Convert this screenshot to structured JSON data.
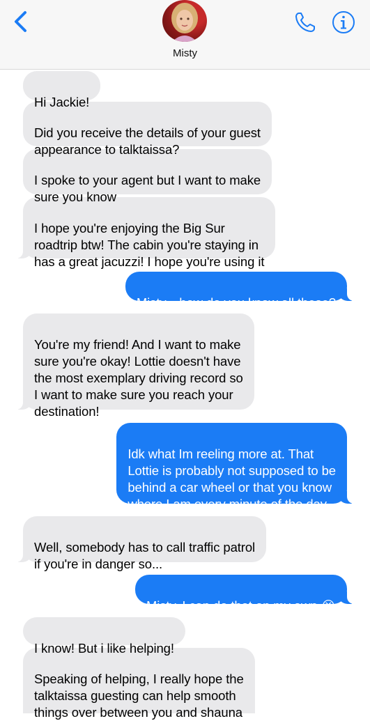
{
  "header": {
    "contact_name": "Misty",
    "back_icon": "chevron-left-icon",
    "phone_icon": "phone-icon",
    "info_icon": "info-icon"
  },
  "colors": {
    "accent": "#1b7cf5",
    "incoming": "#e9e9eb"
  },
  "messages": [
    {
      "dir": "in",
      "text": "Hi Jackie!"
    },
    {
      "dir": "in",
      "text": "Did you receive the details of your guest\nappearance to talktaissa?"
    },
    {
      "dir": "in",
      "text": "I spoke to your agent but I want to make\nsure you know"
    },
    {
      "dir": "in",
      "text": "I hope you're enjoying the Big Sur\nroadtrip btw! The cabin you're staying in\nhas a great jacuzzi! I hope you're using it"
    },
    {
      "dir": "out",
      "text": "Misty... how do you know all these?"
    },
    {
      "dir": "in",
      "text": "You're my friend! And I want to make\nsure you're okay! Lottie doesn't have\nthe most exemplary driving record so\nI want to make sure you reach your\ndestination!"
    },
    {
      "dir": "out",
      "text": "Idk what Im reeling more at. That\nLottie is probably not supposed to be\nbehind a car wheel or that you know\nwhere I am every minute of the day"
    },
    {
      "dir": "in",
      "text": "Well, somebody has to call traffic patrol\nif you're in danger so..."
    },
    {
      "dir": "out",
      "text": "Misty, I can do that on my own 😭"
    },
    {
      "dir": "in",
      "text": "I know! But i like helping!"
    },
    {
      "dir": "in",
      "text": "Speaking of helping, I really hope the\ntalktaissa guesting can help smooth\nthings over between you and shauna"
    }
  ]
}
